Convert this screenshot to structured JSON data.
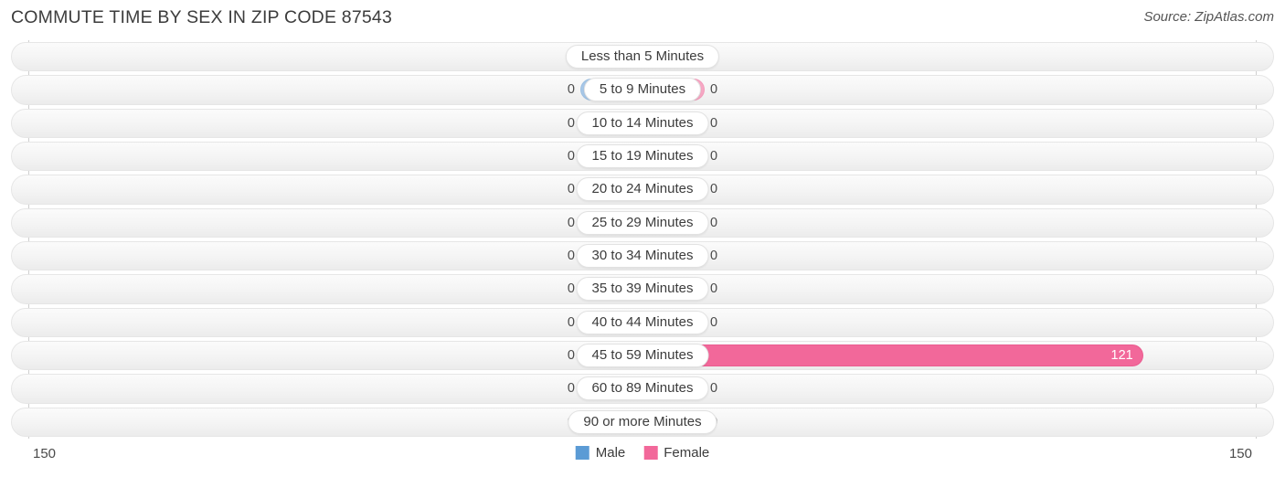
{
  "header": {
    "title": "COMMUTE TIME BY SEX IN ZIP CODE 87543",
    "source": "Source: ZipAtlas.com"
  },
  "legend": {
    "male_label": "Male",
    "female_label": "Female",
    "male_color": "#5b9bd5",
    "female_color": "#f2689a"
  },
  "axis": {
    "left_max": "150",
    "right_max": "150"
  },
  "chart_data": {
    "type": "bar",
    "title": "COMMUTE TIME BY SEX IN ZIP CODE 87543",
    "subtitle": "Source: ZipAtlas.com",
    "orientation": "horizontal-diverging",
    "xlabel": "",
    "ylabel": "",
    "xlim": [
      150,
      150
    ],
    "axis_max_left": 150,
    "axis_max_right": 150,
    "grid": false,
    "legend_position": "bottom-center",
    "categories": [
      "Less than 5 Minutes",
      "5 to 9 Minutes",
      "10 to 14 Minutes",
      "15 to 19 Minutes",
      "20 to 24 Minutes",
      "25 to 29 Minutes",
      "30 to 34 Minutes",
      "35 to 39 Minutes",
      "40 to 44 Minutes",
      "45 to 59 Minutes",
      "60 to 89 Minutes",
      "90 or more Minutes"
    ],
    "series": [
      {
        "name": "Male",
        "color": "#a8c8e8",
        "values": [
          0,
          0,
          0,
          0,
          0,
          0,
          0,
          0,
          0,
          0,
          0,
          0
        ]
      },
      {
        "name": "Female",
        "color": "#f7a8c4",
        "values": [
          0,
          0,
          0,
          0,
          0,
          0,
          0,
          0,
          0,
          121,
          0,
          0
        ]
      }
    ]
  },
  "rows": [
    {
      "label": "Less than 5 Minutes",
      "male": "0",
      "female": "0"
    },
    {
      "label": "5 to 9 Minutes",
      "male": "0",
      "female": "0"
    },
    {
      "label": "10 to 14 Minutes",
      "male": "0",
      "female": "0"
    },
    {
      "label": "15 to 19 Minutes",
      "male": "0",
      "female": "0"
    },
    {
      "label": "20 to 24 Minutes",
      "male": "0",
      "female": "0"
    },
    {
      "label": "25 to 29 Minutes",
      "male": "0",
      "female": "0"
    },
    {
      "label": "30 to 34 Minutes",
      "male": "0",
      "female": "0"
    },
    {
      "label": "35 to 39 Minutes",
      "male": "0",
      "female": "0"
    },
    {
      "label": "40 to 44 Minutes",
      "male": "0",
      "female": "0"
    },
    {
      "label": "45 to 59 Minutes",
      "male": "0",
      "female": "121"
    },
    {
      "label": "60 to 89 Minutes",
      "male": "0",
      "female": "0"
    },
    {
      "label": "90 or more Minutes",
      "male": "0",
      "female": "0"
    }
  ]
}
